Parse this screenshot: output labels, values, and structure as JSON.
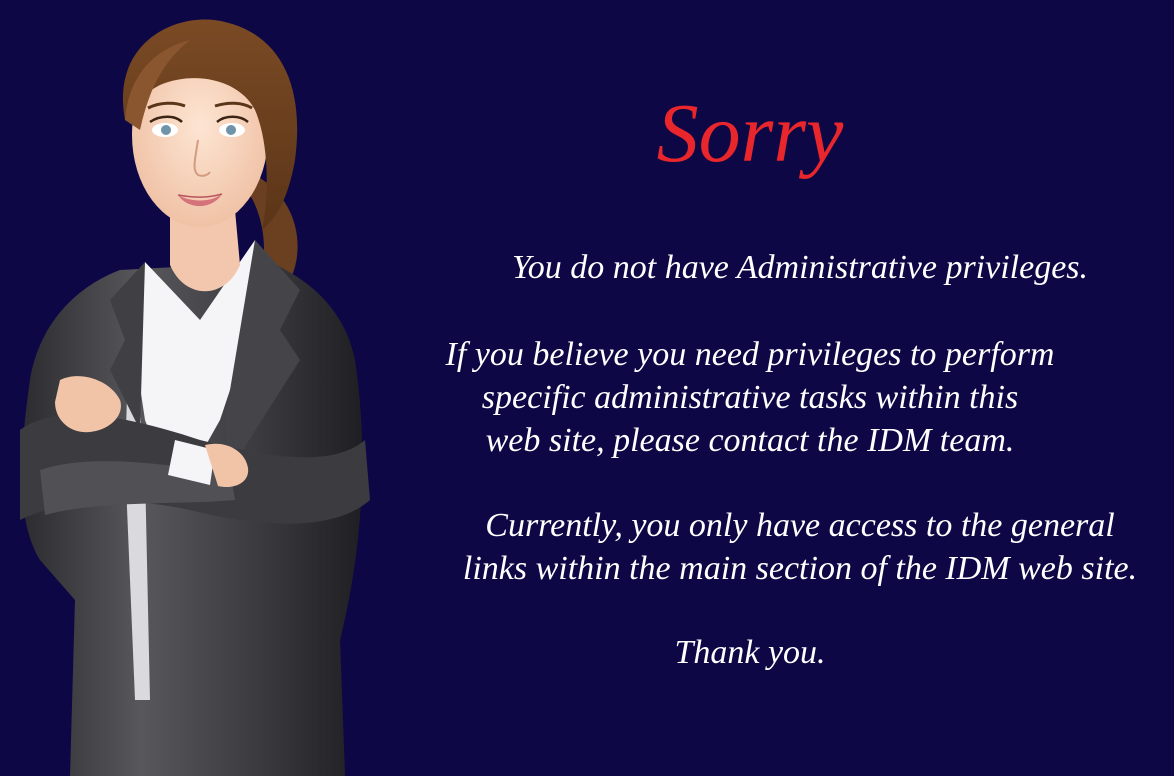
{
  "colors": {
    "background": "#0d0845",
    "title": "#e8262b",
    "text": "#ffffff"
  },
  "illustration": {
    "name": "businesswoman-arms-crossed-illustration"
  },
  "message": {
    "title": "Sorry",
    "paragraph_1": "You do not have Administrative privileges.",
    "paragraph_2": [
      "If you believe you need privileges to perform",
      "specific administrative tasks within this",
      "web site, please contact the IDM team."
    ],
    "paragraph_3": [
      "Currently, you only have access to the general",
      "links within the main section of the IDM web site."
    ],
    "closing": "Thank you."
  }
}
